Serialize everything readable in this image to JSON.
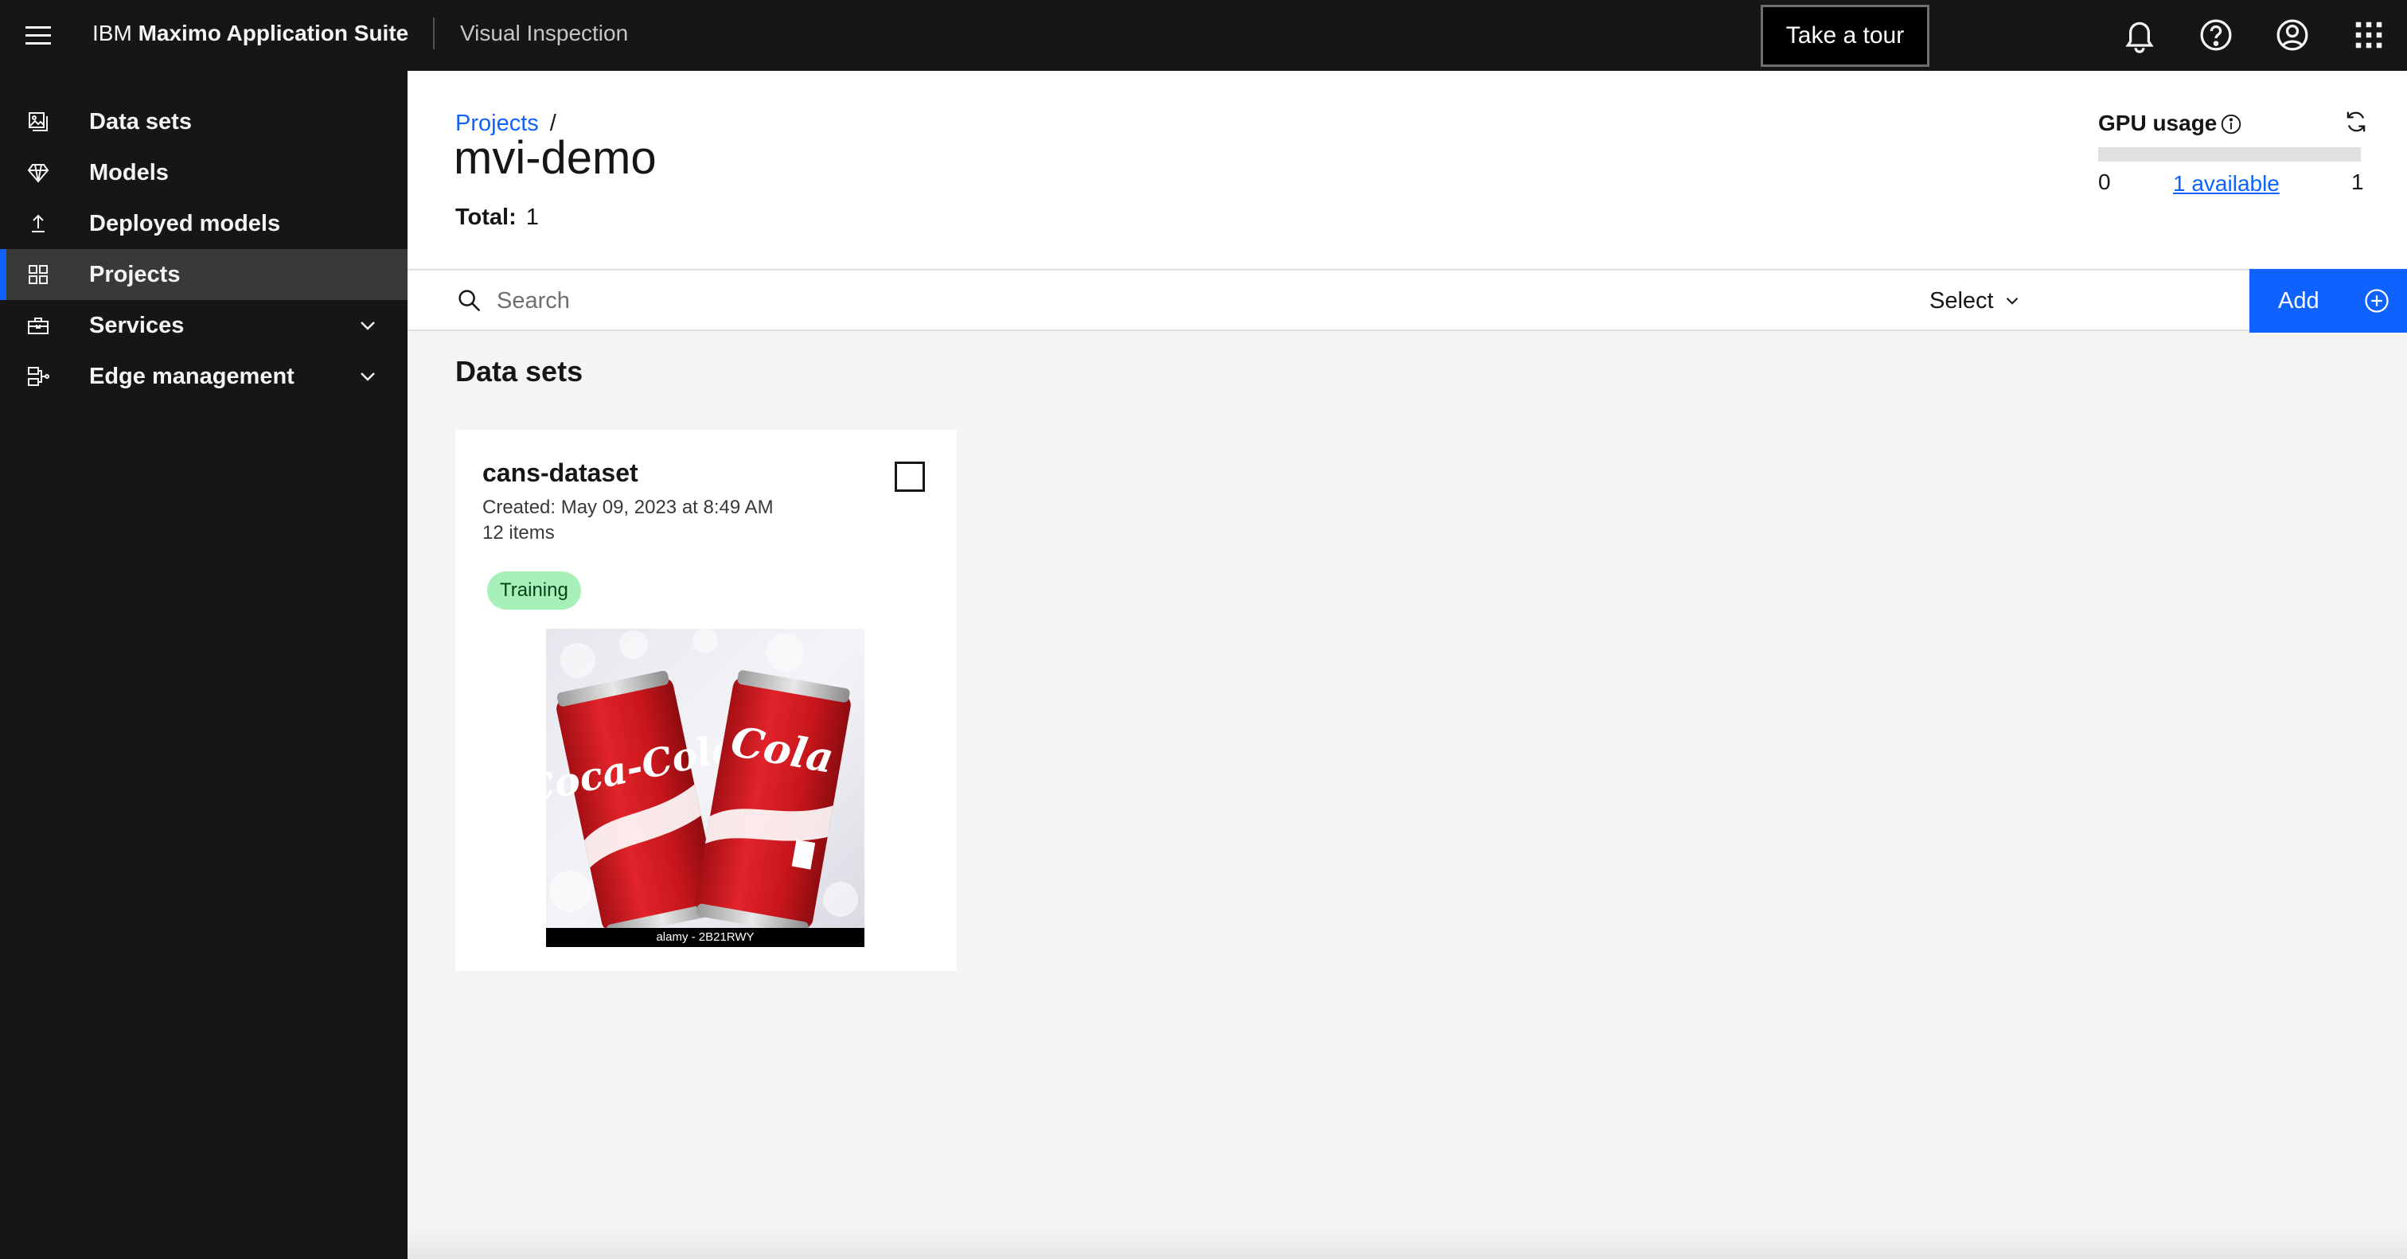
{
  "header": {
    "brand_prefix": "IBM",
    "brand_name": "Maximo Application Suite",
    "product": "Visual Inspection",
    "tour_label": "Take a tour",
    "icons": [
      "notification-icon",
      "help-icon",
      "user-avatar-icon",
      "app-switcher-icon"
    ]
  },
  "sidebar": {
    "items": [
      {
        "label": "Data sets",
        "icon": "data-sets-icon"
      },
      {
        "label": "Models",
        "icon": "diamond-model-icon"
      },
      {
        "label": "Deployed models",
        "icon": "deploy-upload-icon"
      },
      {
        "label": "Projects",
        "icon": "grid-projects-icon",
        "active": true
      },
      {
        "label": "Services",
        "icon": "toolbox-icon",
        "expandable": true
      },
      {
        "label": "Edge management",
        "icon": "edge-node-icon",
        "expandable": true
      }
    ]
  },
  "page": {
    "breadcrumb_root": "Projects",
    "breadcrumb_sep": "/",
    "title": "mvi-demo",
    "total_label": "Total:",
    "total_value": "1"
  },
  "gpu": {
    "title": "GPU usage",
    "min": "0",
    "available": "1 available",
    "max": "1",
    "used_fraction": 0
  },
  "toolbar": {
    "search_placeholder": "Search",
    "select_label": "Select",
    "add_label": "Add"
  },
  "section": {
    "title": "Data sets"
  },
  "cards": [
    {
      "title": "cans-dataset",
      "created": "Created: May 09, 2023 at 8:49 AM",
      "items": "12 items",
      "tag": "Training",
      "thumbnail_caption": "alamy - 2B21RWY",
      "thumbnail_text_left": "Coca-Cola",
      "thumbnail_text_right": "Cola",
      "colors": {
        "tag_bg": "#a7f0ba",
        "tag_fg": "#044317",
        "can_red": "#d8191e"
      }
    }
  ],
  "colors": {
    "header_bg": "#161616",
    "active_nav": "#393939",
    "accent": "#0f62fe",
    "content_bg": "#f4f4f4"
  }
}
